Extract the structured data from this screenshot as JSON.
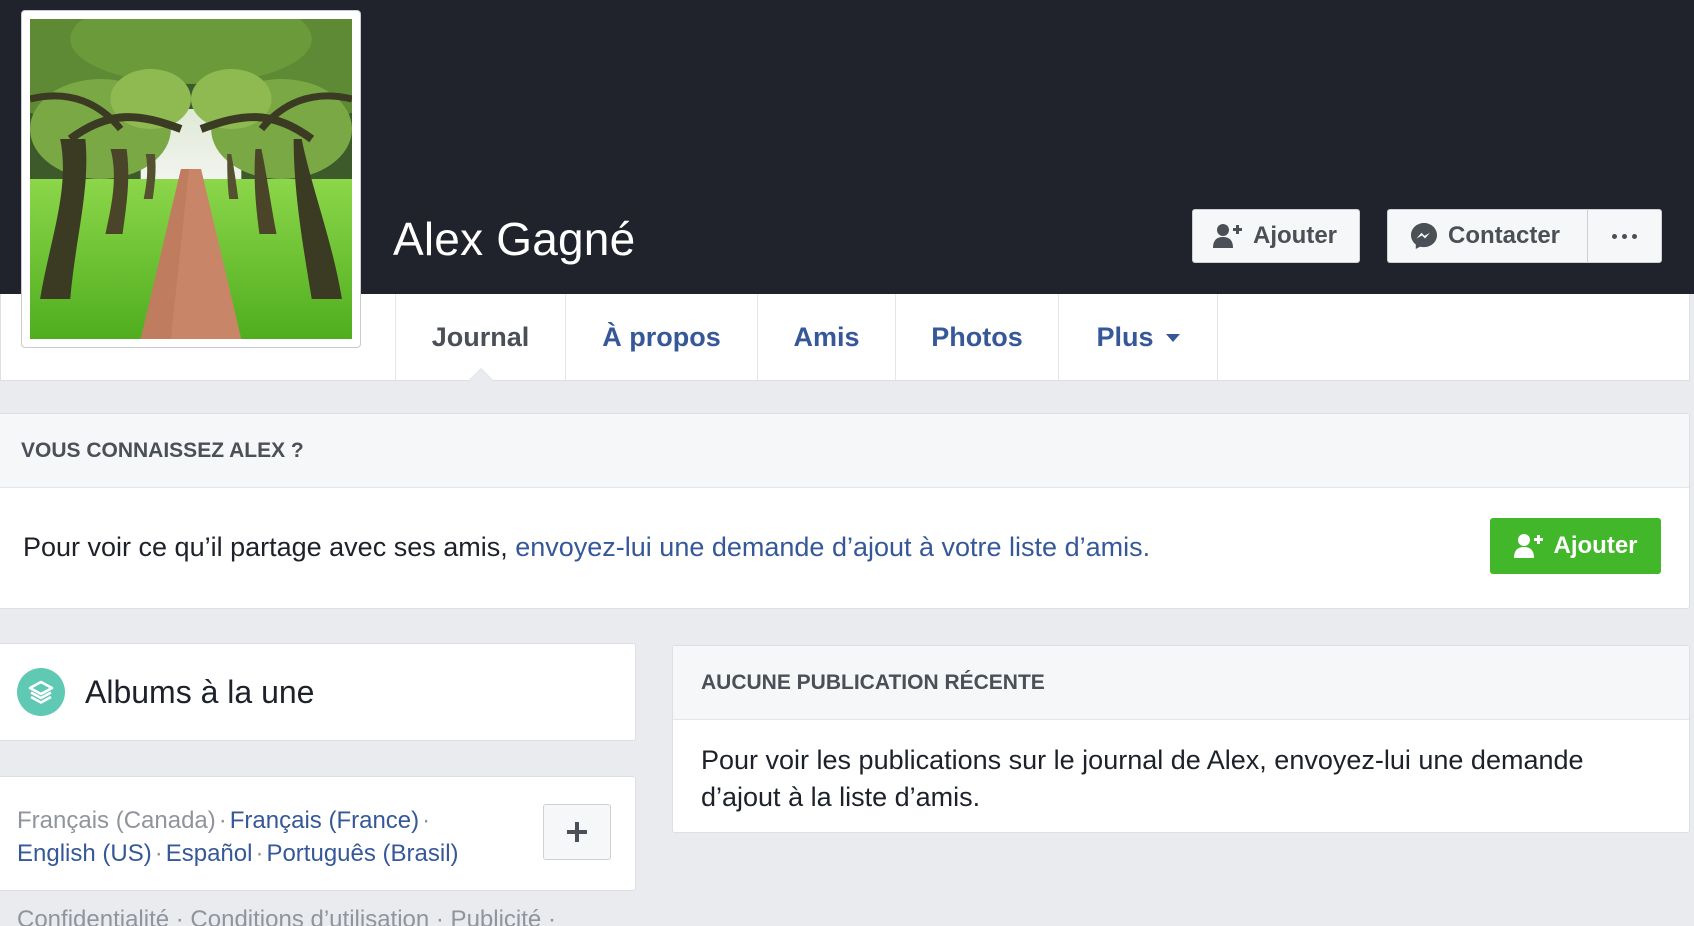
{
  "profile": {
    "name": "Alex Gagné"
  },
  "cover_actions": {
    "add_label": "Ajouter",
    "contact_label": "Contacter"
  },
  "tabs": [
    {
      "label": "Journal",
      "active": true
    },
    {
      "label": "À propos"
    },
    {
      "label": "Amis"
    },
    {
      "label": "Photos"
    },
    {
      "label": "Plus"
    }
  ],
  "know": {
    "heading": "VOUS CONNAISSEZ ALEX ?",
    "text": "Pour voir ce qu’il partage avec ses amis, ",
    "link": "envoyez-lui une demande d’ajout à votre liste d’amis.",
    "button_label": "Ajouter"
  },
  "albums": {
    "title": "Albums à la une"
  },
  "languages": {
    "current": "Français (Canada)",
    "links": [
      "Français (France)",
      "English (US)",
      "Español",
      "Português (Brasil)"
    ]
  },
  "footer": {
    "text": "Confidentialité · Conditions d’utilisation · Publicité ·"
  },
  "no_recent": {
    "heading": "AUCUNE PUBLICATION RÉCENTE",
    "text": "Pour voir les publications sur le journal de Alex, envoyez-lui une demande d’ajout à la liste d’amis."
  },
  "icons": {
    "add_friend": "add-friend-icon",
    "messenger": "messenger-icon",
    "more": "more-dots-icon",
    "caret": "caret-down-icon",
    "albums": "albums-layers-icon",
    "plus": "plus-icon"
  },
  "colors": {
    "cover": "#20232b",
    "link": "#365899",
    "green": "#42b72a",
    "albums_icon": "#5fc9b3"
  }
}
